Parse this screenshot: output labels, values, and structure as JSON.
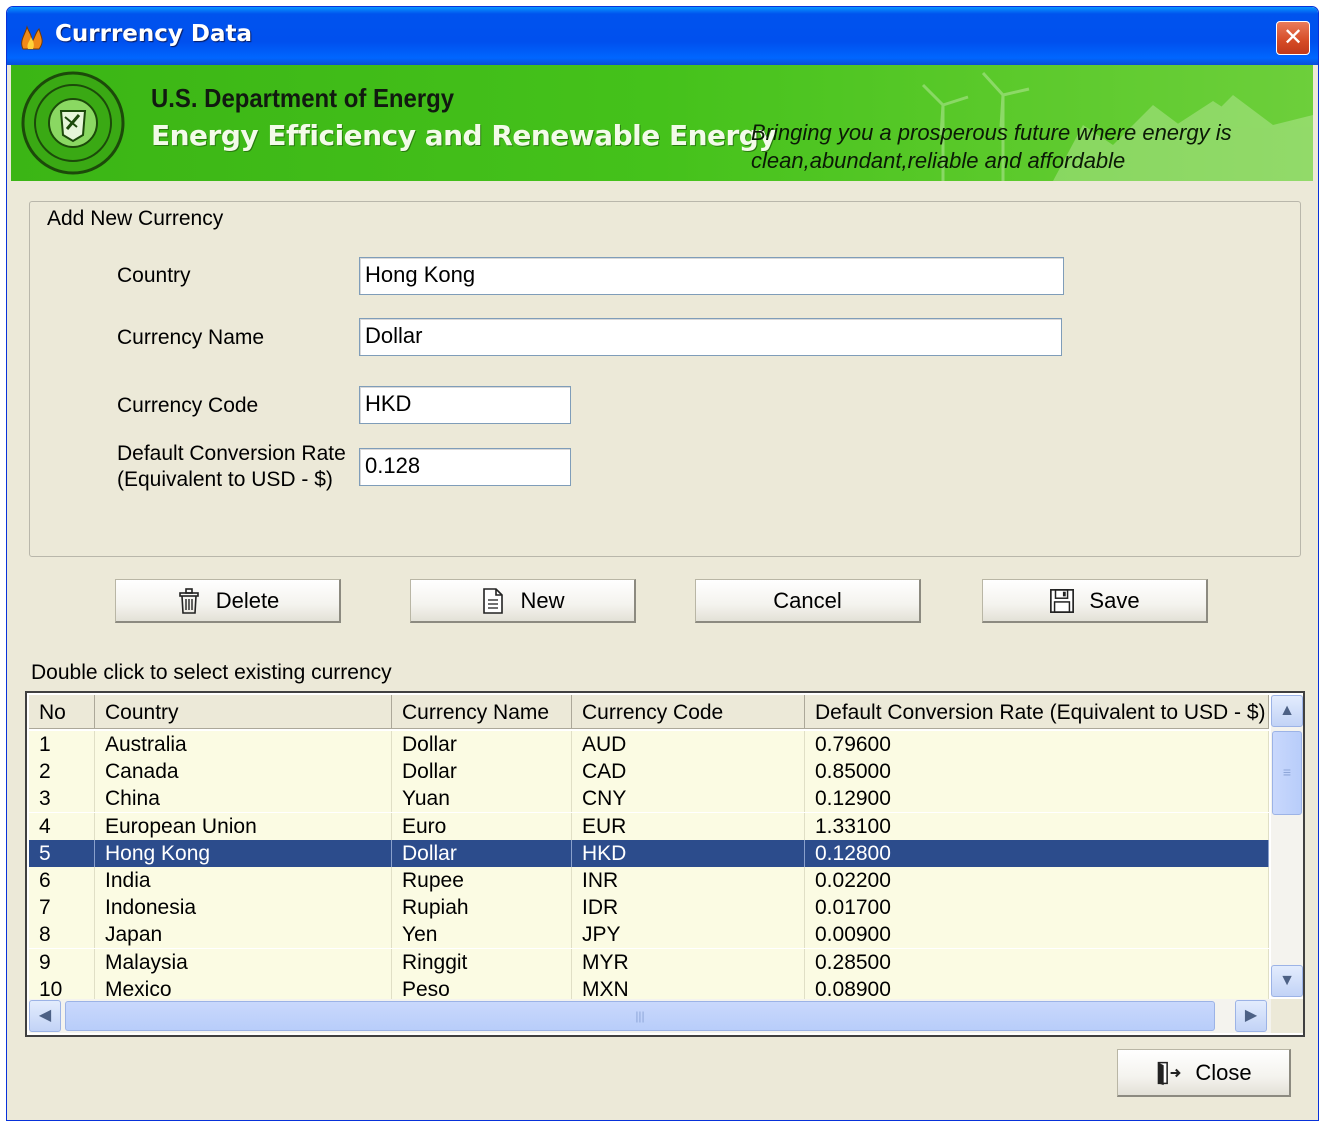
{
  "window": {
    "title": "Currrency Data",
    "close_glyph": "✕"
  },
  "banner": {
    "department": "U.S. Department of Energy",
    "office": "Energy Efficiency and Renewable Energy",
    "tagline": "Bringing you a prosperous future where energy is clean,abundant,reliable and affordable"
  },
  "form": {
    "group_label": "Add New Currency",
    "country_label": "Country",
    "country_value": "Hong Kong",
    "currency_name_label": "Currency Name",
    "currency_name_value": "Dollar",
    "currency_code_label": "Currency Code",
    "currency_code_value": "HKD",
    "rate_label_line1": "Default Conversion Rate",
    "rate_label_line2": "(Equivalent to USD - $)",
    "rate_value": "0.128"
  },
  "buttons": {
    "delete": "Delete",
    "new": "New",
    "cancel": "Cancel",
    "save": "Save",
    "close": "Close"
  },
  "hint": "Double click to select existing currency",
  "table": {
    "columns": [
      "No",
      "Country",
      "Currency Name",
      "Currency Code",
      "Default Conversion Rate (Equivalent to USD - $)"
    ],
    "selected_index": 4,
    "rows": [
      [
        "1",
        "Australia",
        "Dollar",
        "AUD",
        "0.79600"
      ],
      [
        "2",
        "Canada",
        "Dollar",
        "CAD",
        "0.85000"
      ],
      [
        "3",
        "China",
        "Yuan",
        "CNY",
        "0.12900"
      ],
      [
        "4",
        "European Union",
        "Euro",
        "EUR",
        "1.33100"
      ],
      [
        "5",
        "Hong Kong",
        "Dollar",
        "HKD",
        "0.12800"
      ],
      [
        "6",
        "India",
        "Rupee",
        "INR",
        "0.02200"
      ],
      [
        "7",
        "Indonesia",
        "Rupiah",
        "IDR",
        "0.01700"
      ],
      [
        "8",
        "Japan",
        "Yen",
        "JPY",
        "0.00900"
      ],
      [
        "9",
        "Malaysia",
        "Ringgit",
        "MYR",
        "0.28500"
      ],
      [
        "10",
        "Mexico",
        "Peso",
        "MXN",
        "0.08900"
      ]
    ]
  },
  "colors": {
    "title_bar": "#0053ee",
    "banner_green": "#45c21b",
    "selected_row": "#2c4c8c",
    "row_background": "#fbfbe3",
    "dialog_background": "#ece9d8"
  },
  "icons": {
    "app": "flame-icon",
    "seal": "doe-seal-icon",
    "delete": "trash-icon",
    "new": "document-icon",
    "save": "floppy-disk-icon",
    "close": "exit-door-icon"
  }
}
